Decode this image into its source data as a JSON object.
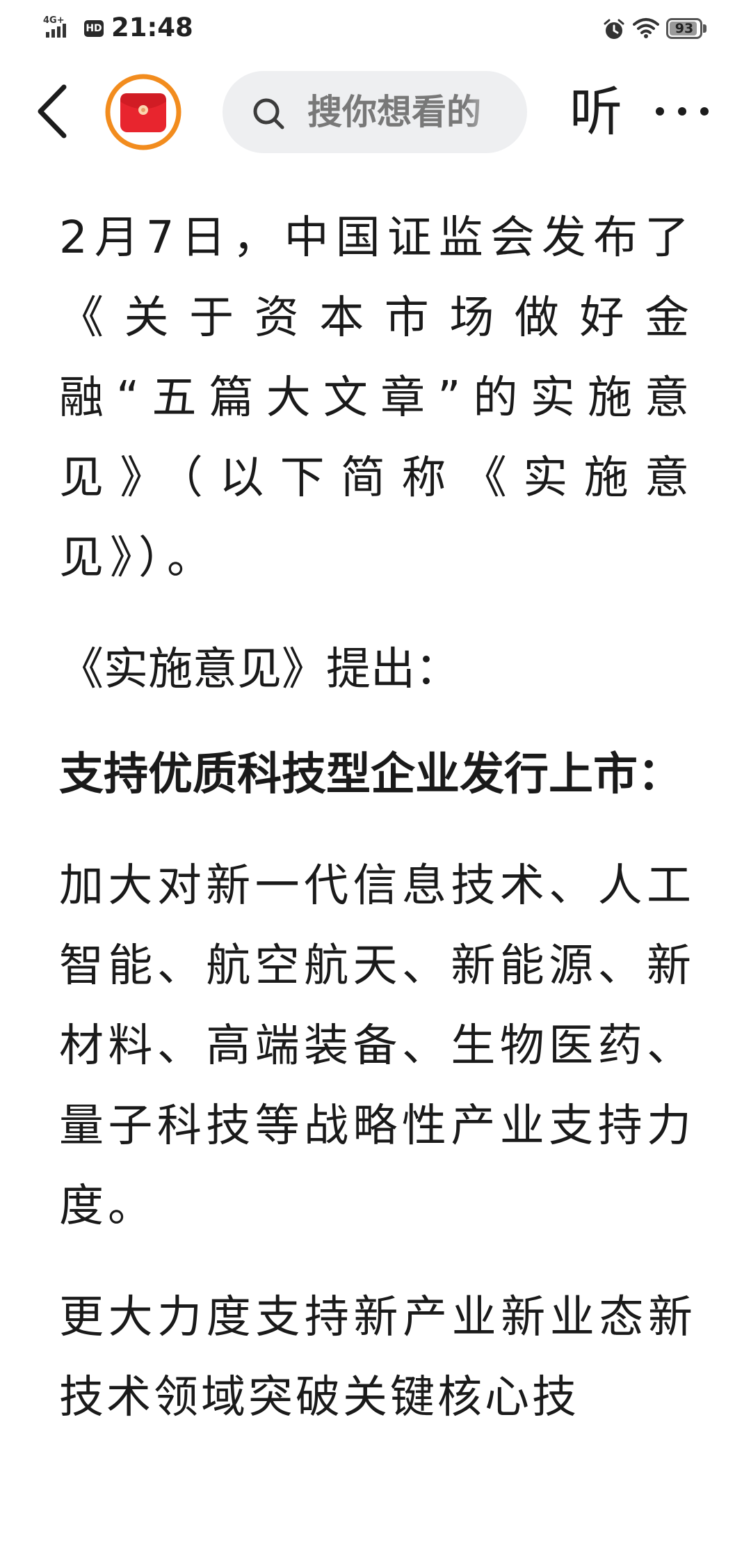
{
  "status_bar": {
    "network": "4G+",
    "hd_badge": "HD",
    "time": "21:48",
    "battery_level": "93",
    "battery_fraction": 0.93,
    "icons": [
      "signal-icon",
      "alarm-icon",
      "wifi-icon",
      "battery-icon"
    ]
  },
  "header": {
    "back_icon": "chevron-left-icon",
    "redpacket_icon": "red-envelope-icon",
    "search_placeholder": "搜你想看的",
    "listen_label": "听",
    "more_icon": "more-dots-icon"
  },
  "article": {
    "paragraphs": [
      "2月7日，中国证监会发布了《关于资本市场做好金融“五篇大文章”的实施意见》（以下简称《实施意见》）。",
      "《实施意见》提出：",
      "支持优质科技型企业发行上市：",
      "加大对新一代信息技术、人工智能、航空航天、新能源、新材料、高端装备、生物医药、量子科技等战略性产业支持力度。",
      "更大力度支持新产业新业态新技术领域突破关键核心技"
    ]
  },
  "colors": {
    "text": "#1a1a1a",
    "search_bg": "#eeeff1",
    "search_text": "#787878",
    "redpacket_orange": "#f28c1e",
    "redpacket_red": "#e8252e"
  }
}
